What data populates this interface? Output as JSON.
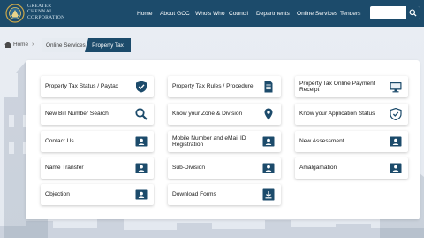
{
  "header": {
    "brand_line1": "Greater",
    "brand_line2": "Chennai",
    "brand_line3": "Corporation",
    "nav": [
      "Home",
      "About GCC",
      "Who's Who",
      "Council",
      "Departments",
      "Online Services",
      "Tenders"
    ],
    "search_placeholder": ""
  },
  "breadcrumb": {
    "home": "Home",
    "online_services": "Online Services",
    "current": "Property Tax"
  },
  "services": [
    {
      "label": "Property Tax Status / Paytax",
      "icon": "shield-check-icon"
    },
    {
      "label": "Property Tax Rules / Procedure",
      "icon": "document-icon"
    },
    {
      "label": "Property Tax Online Payment Receipt",
      "icon": "monitor-icon"
    },
    {
      "label": "New Bill Number Search",
      "icon": "search-icon"
    },
    {
      "label": "Know your Zone & Division",
      "icon": "location-pin-icon"
    },
    {
      "label": "Know your Application Status",
      "icon": "shield-check-icon"
    },
    {
      "label": "Contact Us",
      "icon": "id-card-icon"
    },
    {
      "label": "Mobile Number and eMail ID Registration",
      "icon": "id-card-icon"
    },
    {
      "label": "New Assessment",
      "icon": "id-card-icon"
    },
    {
      "label": "Name Transfer",
      "icon": "id-card-icon"
    },
    {
      "label": "Sub-Division",
      "icon": "id-card-icon"
    },
    {
      "label": "Amalgamation",
      "icon": "id-card-icon"
    },
    {
      "label": "Objection",
      "icon": "id-card-icon"
    },
    {
      "label": "Download Forms",
      "icon": "download-icon"
    }
  ],
  "colors": {
    "primary": "#1c4b6b",
    "icon": "#1c4b6b",
    "background": "#eef1f6"
  }
}
